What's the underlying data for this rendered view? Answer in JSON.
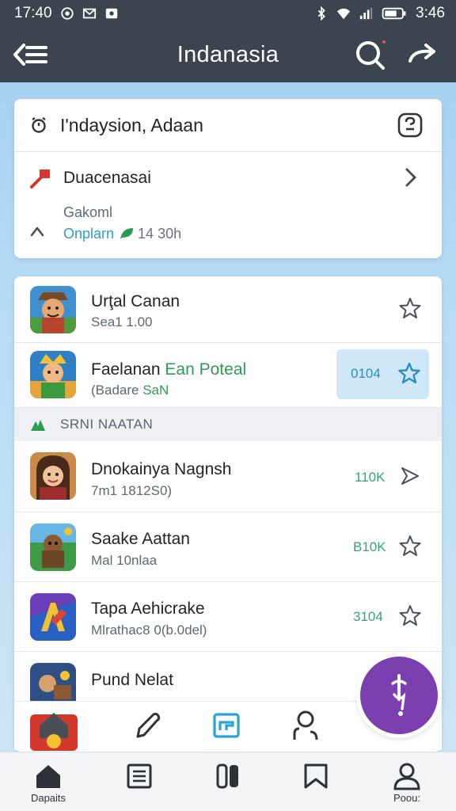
{
  "status": {
    "time": "17:40",
    "time_right": "3:46",
    "icons": [
      "whatsapp-icon",
      "mail-icon",
      "gallery-icon",
      "bluetooth-icon",
      "wifi-icon",
      "signal-icon",
      "battery-icon"
    ]
  },
  "appbar": {
    "title": "Indanasia",
    "icons": [
      "back-menu-icon",
      "search-icon",
      "share-icon"
    ]
  },
  "info_card": {
    "title": "I'ndaysion, Adaan",
    "item_label": "Duacenasai",
    "sub1": "Gakoml",
    "sub2_link": "Onplarn",
    "sub2_meta": "14 30h"
  },
  "list": {
    "items": [
      {
        "title": "Urţal Canan",
        "subtitle": "Sea1 1.00",
        "count": "",
        "highlight": false
      },
      {
        "title": "Faelanan",
        "title_highlight": "Ean Poteal",
        "subtitle": "(Badare",
        "subtitle_highlight": "SaN",
        "count": "0104",
        "highlight": true
      }
    ],
    "section_label": "SRNI NAATAN",
    "more_items": [
      {
        "title": "Dnokainya Nagnsh",
        "subtitle": "7m1 1812S0)",
        "count": "110K"
      },
      {
        "title": "Saake Aattan",
        "subtitle": "Mal 10nlaa",
        "count": "B10K"
      },
      {
        "title": "Tapa Aehicrake",
        "subtitle": "Mlrathac8 0(b.0del)",
        "count": "3104"
      },
      {
        "title": "Pund Nelat",
        "subtitle": "",
        "count": ""
      }
    ]
  },
  "bottom_nav": {
    "items": [
      {
        "label": "Dapaits",
        "icon": "home-icon"
      },
      {
        "label": "",
        "icon": "news-icon"
      },
      {
        "label": "",
        "icon": "library-icon"
      },
      {
        "label": "",
        "icon": "bookmark-icon"
      },
      {
        "label": "Poou:",
        "icon": "profile-icon"
      }
    ]
  },
  "colors": {
    "appbar_bg": "#3c4450",
    "accent_blue": "#2a8dc4",
    "accent_green": "#2e9a52",
    "fab_purple": "#7b3fb0"
  }
}
